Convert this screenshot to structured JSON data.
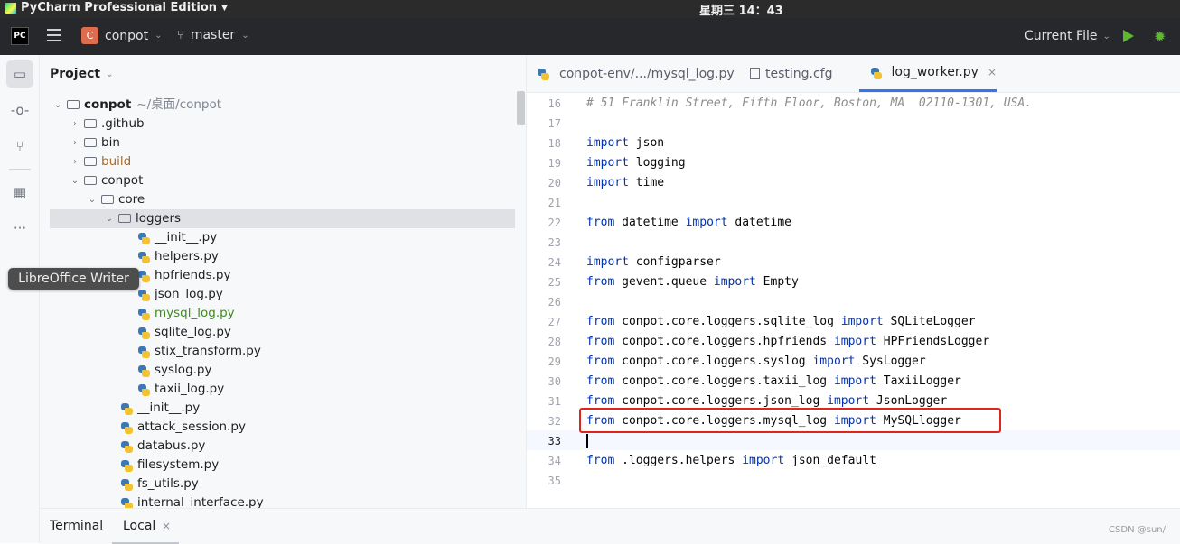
{
  "system_bar": {
    "app_name": "PyCharm Professional Edition",
    "clock": "星期三 14：43"
  },
  "toolbar": {
    "logo_text": "PC",
    "project_badge": "C",
    "project_name": "conpot",
    "branch": "master",
    "run_config": "Current File"
  },
  "tooltip": "LibreOffice Writer",
  "project_panel": {
    "title": "Project",
    "tree": [
      {
        "label": "conpot",
        "note": "~/桌面/conpot"
      },
      {
        "label": ".github"
      },
      {
        "label": "bin"
      },
      {
        "label": "build"
      },
      {
        "label": "conpot"
      },
      {
        "label": "core"
      },
      {
        "label": "loggers"
      },
      {
        "label": "__init__.py"
      },
      {
        "label": "helpers.py"
      },
      {
        "label": "hpfriends.py"
      },
      {
        "label": "json_log.py"
      },
      {
        "label": "mysql_log.py"
      },
      {
        "label": "sqlite_log.py"
      },
      {
        "label": "stix_transform.py"
      },
      {
        "label": "syslog.py"
      },
      {
        "label": "taxii_log.py"
      },
      {
        "label": "__init__.py"
      },
      {
        "label": "attack_session.py"
      },
      {
        "label": "databus.py"
      },
      {
        "label": "filesystem.py"
      },
      {
        "label": "fs_utils.py"
      },
      {
        "label": "internal_interface.py"
      }
    ]
  },
  "editor_tabs": [
    {
      "label": "conpot-env/.../mysql_log.py"
    },
    {
      "label": "testing.cfg"
    },
    {
      "label": "log_worker.py",
      "close": "×"
    }
  ],
  "editor": {
    "line_numbers": [
      "16",
      "17",
      "18",
      "19",
      "20",
      "21",
      "22",
      "23",
      "24",
      "25",
      "26",
      "27",
      "28",
      "29",
      "30",
      "31",
      "32",
      "33",
      "34",
      "35"
    ],
    "comment_line": "# 51 Franklin Street, Fifth Floor, Boston, MA  02110-1301, USA.",
    "kw": {
      "import": "import",
      "from": "from"
    },
    "mods": {
      "json": " json",
      "logging": " logging",
      "time": " time",
      "datetime_mod": " datetime ",
      "datetime_cls": " datetime",
      "configparser": " configparser",
      "gevent": " gevent.queue ",
      "empty": " Empty",
      "sqlite": " conpot.core.loggers.sqlite_log ",
      "sqlite_cls": " SQLiteLogger",
      "hpfriends": " conpot.core.loggers.hpfriends ",
      "hpfriends_cls": " HPFriendsLogger",
      "syslog": " conpot.core.loggers.syslog ",
      "syslog_cls": " SysLogger",
      "taxii": " conpot.core.loggers.taxii_log ",
      "taxii_cls": " TaxiiLogger",
      "jsonlog": " conpot.core.loggers.json_log ",
      "jsonlog_cls": " JsonLogger",
      "mysql": " conpot.core.loggers.mysql_log ",
      "mysql_cls": " MySQLlogger",
      "helpers": " .loggers.helpers ",
      "helpers_fn": " json_default"
    }
  },
  "bottom_bar": {
    "terminal": "Terminal",
    "local": "Local",
    "close": "×",
    "watermark": "CSDN @sun/"
  }
}
